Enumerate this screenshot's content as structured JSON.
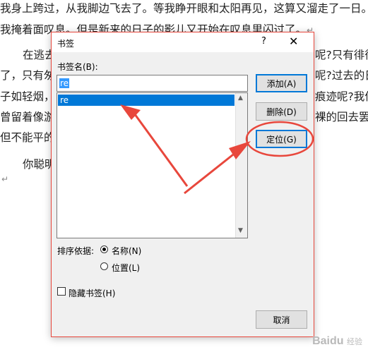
{
  "document": {
    "lines": [
      "我身上跨过，从我脚边飞去了。等我睁开眼和太阳再见，这算又溜走了一日。",
      "我掩着面叹息。但是新来的日子的影儿又开始在叹息里闪过了。",
      "在逃去",
      "了，只有匆",
      "子如轻烟，",
      "曾留着像游",
      "但不能平的",
      "你聪明"
    ],
    "right_fragments": [
      "呢?只有徘徊",
      "呢?过去的日",
      "痕迹呢?我何",
      "裸的回去罢"
    ],
    "paragraph_mark": "↵"
  },
  "dialog": {
    "title": "书签",
    "help": "?",
    "close": "✕",
    "name_label": "书签名(B):",
    "input_value": "re",
    "list_items": [
      "re"
    ],
    "buttons": {
      "add": "添加(A)",
      "delete": "删除(D)",
      "goto": "定位(G)",
      "cancel": "取消"
    },
    "sort_label": "排序依据:",
    "sort_options": {
      "name": "名称(N)",
      "location": "位置(L)"
    },
    "sort_selected": "name",
    "hidden_bookmarks_label": "隐藏书签(H)",
    "hidden_checked": false
  },
  "watermark": {
    "text": "Baidu",
    "sub": "经验"
  },
  "colors": {
    "accent": "#0078d7",
    "annotation": "#e8473c"
  }
}
